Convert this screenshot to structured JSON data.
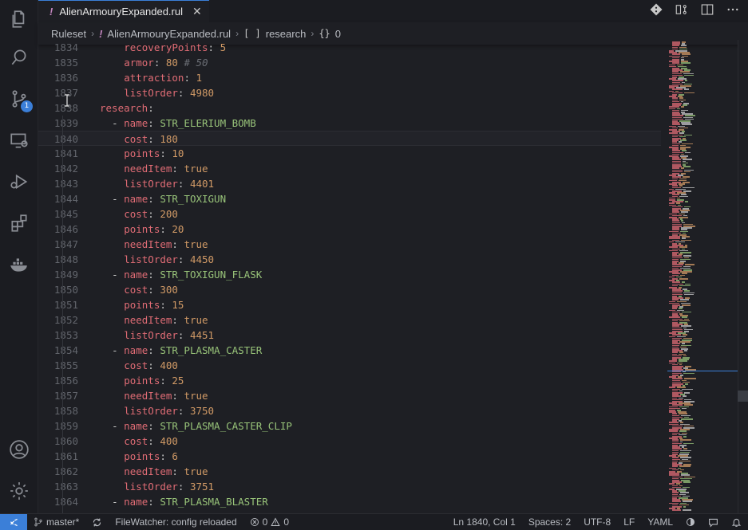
{
  "tab": {
    "icon": "!",
    "title": "AlienArmouryExpanded.rul",
    "close": "✕"
  },
  "breadcrumb": {
    "items": [
      "Ruleset",
      "AlienArmouryExpanded.rul",
      "research",
      "0"
    ],
    "symbols": [
      "[ ]",
      "{}"
    ],
    "separator": "›"
  },
  "activity_bar": {
    "icons": [
      "files-icon",
      "search-icon",
      "source-control-icon",
      "remote-explorer-icon",
      "run-debug-icon",
      "extensions-icon",
      "docker-icon",
      "account-icon",
      "settings-gear-icon"
    ],
    "source_control_badge": "1"
  },
  "editor": {
    "current_line": "1840",
    "lines": [
      {
        "n": "1834",
        "indent": 4,
        "key": "recoveryPoints",
        "value": "5",
        "vtype": "n"
      },
      {
        "n": "1835",
        "indent": 4,
        "key": "armor",
        "value": "80",
        "vtype": "n",
        "comment": "# 50"
      },
      {
        "n": "1836",
        "indent": 4,
        "key": "attraction",
        "value": "1",
        "vtype": "n"
      },
      {
        "n": "1837",
        "indent": 4,
        "key": "listOrder",
        "value": "4980",
        "vtype": "n"
      },
      {
        "n": "1838",
        "indent": 0,
        "key": "research",
        "value": "",
        "vtype": "n"
      },
      {
        "n": "1839",
        "indent": 2,
        "dash": true,
        "key": "name",
        "value": "STR_ELERIUM_BOMB",
        "vtype": "s"
      },
      {
        "n": "1840",
        "indent": 4,
        "key": "cost",
        "value": "180",
        "vtype": "n"
      },
      {
        "n": "1841",
        "indent": 4,
        "key": "points",
        "value": "10",
        "vtype": "n"
      },
      {
        "n": "1842",
        "indent": 4,
        "key": "needItem",
        "value": "true",
        "vtype": "n"
      },
      {
        "n": "1843",
        "indent": 4,
        "key": "listOrder",
        "value": "4401",
        "vtype": "n"
      },
      {
        "n": "1844",
        "indent": 2,
        "dash": true,
        "key": "name",
        "value": "STR_TOXIGUN",
        "vtype": "s"
      },
      {
        "n": "1845",
        "indent": 4,
        "key": "cost",
        "value": "200",
        "vtype": "n"
      },
      {
        "n": "1846",
        "indent": 4,
        "key": "points",
        "value": "20",
        "vtype": "n"
      },
      {
        "n": "1847",
        "indent": 4,
        "key": "needItem",
        "value": "true",
        "vtype": "n"
      },
      {
        "n": "1848",
        "indent": 4,
        "key": "listOrder",
        "value": "4450",
        "vtype": "n"
      },
      {
        "n": "1849",
        "indent": 2,
        "dash": true,
        "key": "name",
        "value": "STR_TOXIGUN_FLASK",
        "vtype": "s"
      },
      {
        "n": "1850",
        "indent": 4,
        "key": "cost",
        "value": "300",
        "vtype": "n"
      },
      {
        "n": "1851",
        "indent": 4,
        "key": "points",
        "value": "15",
        "vtype": "n"
      },
      {
        "n": "1852",
        "indent": 4,
        "key": "needItem",
        "value": "true",
        "vtype": "n"
      },
      {
        "n": "1853",
        "indent": 4,
        "key": "listOrder",
        "value": "4451",
        "vtype": "n"
      },
      {
        "n": "1854",
        "indent": 2,
        "dash": true,
        "key": "name",
        "value": "STR_PLASMA_CASTER",
        "vtype": "s"
      },
      {
        "n": "1855",
        "indent": 4,
        "key": "cost",
        "value": "400",
        "vtype": "n"
      },
      {
        "n": "1856",
        "indent": 4,
        "key": "points",
        "value": "25",
        "vtype": "n"
      },
      {
        "n": "1857",
        "indent": 4,
        "key": "needItem",
        "value": "true",
        "vtype": "n"
      },
      {
        "n": "1858",
        "indent": 4,
        "key": "listOrder",
        "value": "3750",
        "vtype": "n"
      },
      {
        "n": "1859",
        "indent": 2,
        "dash": true,
        "key": "name",
        "value": "STR_PLASMA_CASTER_CLIP",
        "vtype": "s"
      },
      {
        "n": "1860",
        "indent": 4,
        "key": "cost",
        "value": "400",
        "vtype": "n"
      },
      {
        "n": "1861",
        "indent": 4,
        "key": "points",
        "value": "6",
        "vtype": "n"
      },
      {
        "n": "1862",
        "indent": 4,
        "key": "needItem",
        "value": "true",
        "vtype": "n"
      },
      {
        "n": "1863",
        "indent": 4,
        "key": "listOrder",
        "value": "3751",
        "vtype": "n"
      },
      {
        "n": "1864",
        "indent": 2,
        "dash": true,
        "key": "name",
        "value": "STR_PLASMA_BLASTER",
        "vtype": "s"
      }
    ]
  },
  "statusbar": {
    "remote_icon": "remote-icon",
    "branch": "master*",
    "filewatcher": "FileWatcher: config reloaded",
    "errors": "0",
    "warnings": "0",
    "position": "Ln 1840, Col 1",
    "spaces": "Spaces: 2",
    "encoding": "UTF-8",
    "eol": "LF",
    "language": "YAML"
  },
  "colors": {
    "accent": "#3b7fd8",
    "key": "#e06c75",
    "number": "#d19a66",
    "string": "#98c379",
    "background": "#1e1f24"
  }
}
